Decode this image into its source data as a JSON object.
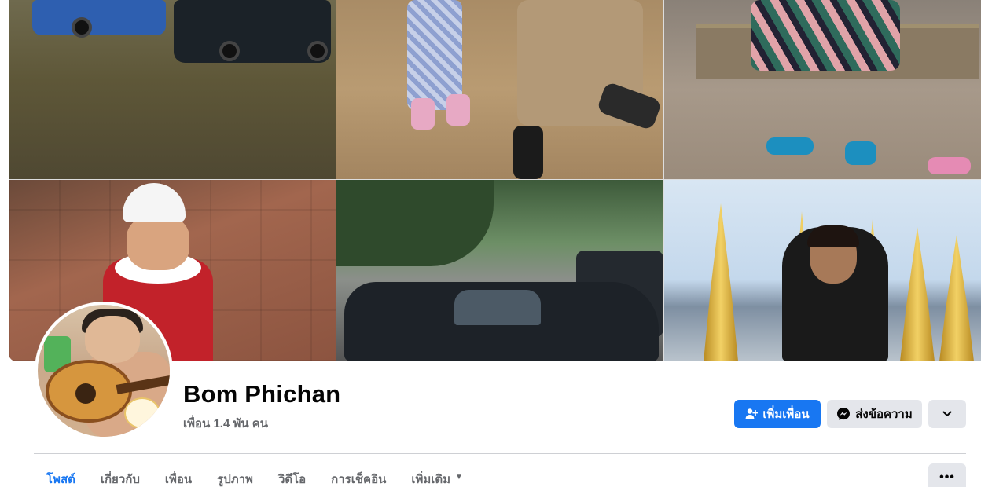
{
  "profile": {
    "name": "Bom Phichan",
    "friends_text": "เพื่อน 1.4 พัน คน"
  },
  "actions": {
    "add_friend_label": "เพิ่มเพื่อน",
    "add_friend_icon": "add-friend-icon",
    "message_label": "ส่งข้อความ",
    "message_icon": "messenger-icon",
    "more_icon": "chevron-down-icon"
  },
  "tabs": [
    {
      "label": "โพสต์",
      "active": true
    },
    {
      "label": "เกี่ยวกับ",
      "active": false
    },
    {
      "label": "เพื่อน",
      "active": false
    },
    {
      "label": "รูปภาพ",
      "active": false
    },
    {
      "label": "วิดีโอ",
      "active": false
    },
    {
      "label": "การเช็คอิน",
      "active": false
    },
    {
      "label": "เพิ่มเติม",
      "active": false,
      "has_dropdown": true
    }
  ],
  "tabs_more_icon": "more-dots-icon",
  "colors": {
    "primary": "#1877f2",
    "secondary_button": "#e4e6eb",
    "muted_text": "#65676b",
    "text": "#050505"
  }
}
